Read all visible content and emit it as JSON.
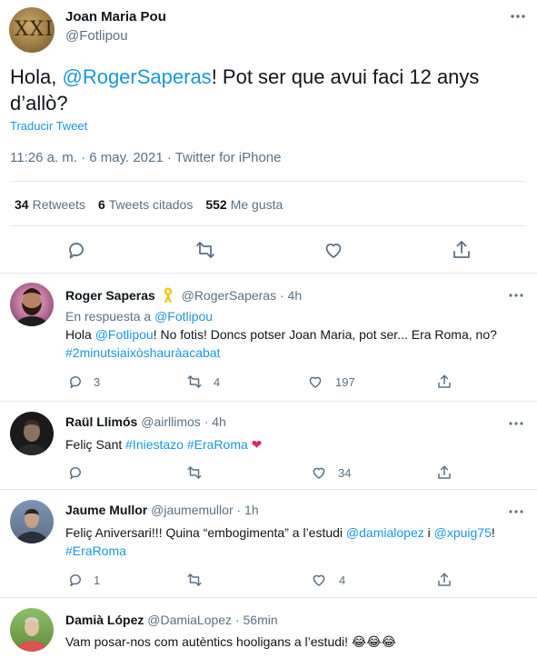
{
  "main_tweet": {
    "name": "Joan Maria Pou",
    "handle": "@Fotlipou",
    "avatar_text": "XXII",
    "text_before": "Hola, ",
    "mention": "@RogerSaperas",
    "text_after": "! Pot ser que avui faci 12 anys d’allò?",
    "translate_label": "Traducir Tweet",
    "timestamp": "11:26 a. m. · 6 may. 2021 · Twitter for iPhone",
    "stats": {
      "retweets_count": "34",
      "retweets_label": "Retweets",
      "quotes_count": "6",
      "quotes_label": "Tweets citados",
      "likes_count": "552",
      "likes_label": "Me gusta"
    }
  },
  "replies": [
    {
      "name": "Roger Saperas",
      "handle": "@RogerSaperas · 4h",
      "reply_to_label": "En respuesta a",
      "reply_to_handle": "@Fotlipou",
      "text_1": "Hola ",
      "mention_1": "@Fotlipou",
      "text_2": "! No fotis! Doncs potser Joan Maria, pot ser... Era Roma, no?",
      "hashtag_1": "#2minutsiaixòshauràacabat",
      "replies": "3",
      "retweets": "4",
      "likes": "197"
    },
    {
      "name": "Raül Llimós",
      "handle": "@airllimos · 4h",
      "text_1": "Feliç Sant ",
      "hashtag_1": "#Iniestazo",
      "hashtag_2": "#EraRoma",
      "emoji": "❤",
      "likes": "34"
    },
    {
      "name": "Jaume Mullor",
      "handle": "@jaumemullor · 1h",
      "text_1": "Feliç Aniversari!!! Quina “embogimenta” a l’estudi ",
      "mention_1": "@damialopez",
      "text_2": " i ",
      "mention_2": "@xpuig75",
      "text_3": "!",
      "hashtag_1": "#EraRoma",
      "replies": "1",
      "likes": "4"
    },
    {
      "name": "Damià López",
      "handle": "@DamiaLopez · 56min",
      "text_1": "Vam posar-nos com autèntics hooligans a l’estudi! ",
      "emoji": "😂😂😂"
    }
  ],
  "icons": {
    "reply": "reply-icon",
    "retweet": "retweet-icon",
    "like": "heart-icon",
    "share": "share-icon",
    "more": "more-icon",
    "ribbon": "yellow-ribbon-icon"
  },
  "colors": {
    "link": "#1b95e0",
    "muted": "#5b7083",
    "border": "#e1e8ed",
    "heart": "#e0245e",
    "ribbon": "#f5c518"
  }
}
